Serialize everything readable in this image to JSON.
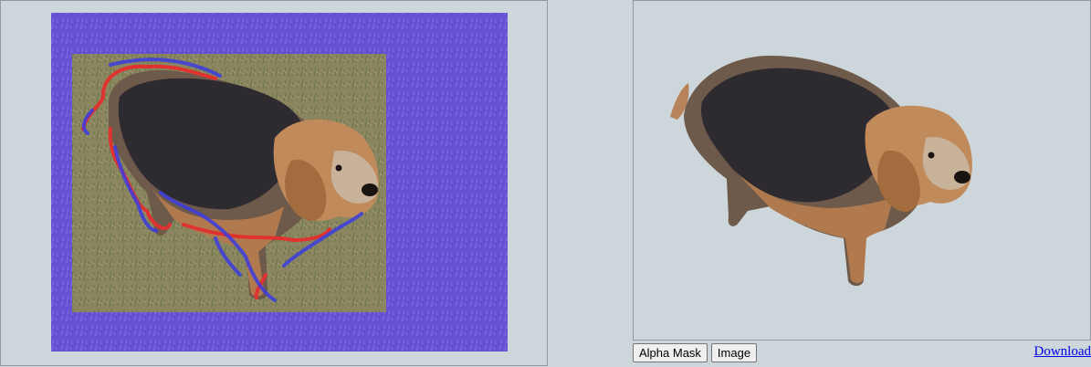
{
  "toolbar": {
    "alpha_mask_label": "Alpha Mask",
    "image_label": "Image"
  },
  "download": {
    "label": "Download"
  },
  "colors": {
    "background_overlay": "#6a55d6",
    "foreground_stroke": "#e0322f",
    "background_stroke": "#3b3ce0",
    "link": "#0000ee",
    "panel_bg": "#cdd6da"
  }
}
